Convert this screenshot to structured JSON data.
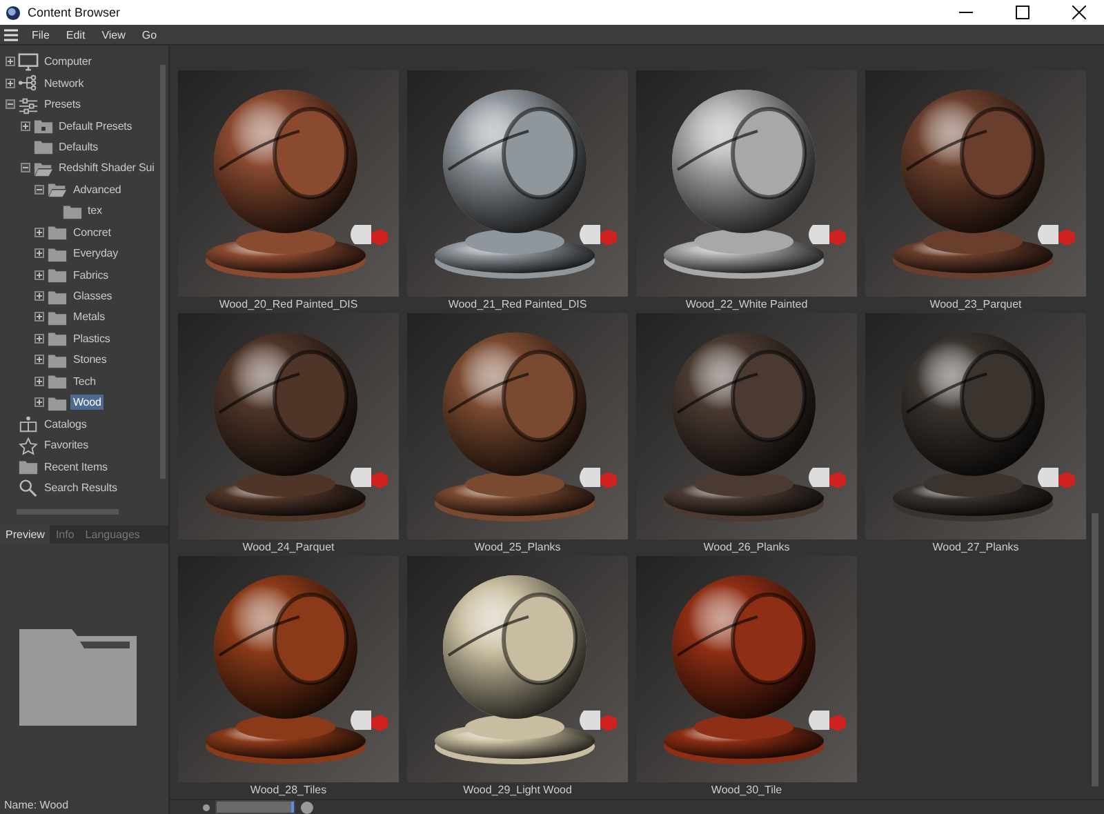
{
  "window": {
    "title": "Content Browser"
  },
  "menu": [
    "File",
    "Edit",
    "View",
    "Go"
  ],
  "tree": [
    {
      "label": "Computer",
      "kind": "monitor",
      "toggle": true,
      "expanded": false,
      "selected": false
    },
    {
      "label": "Network",
      "kind": "network",
      "toggle": true,
      "expanded": false,
      "selected": false
    },
    {
      "label": "Presets",
      "kind": "sliders",
      "toggle": true,
      "expanded": true,
      "selected": false,
      "children": [
        {
          "label": "Default Presets",
          "kind": "folder-lock",
          "toggle": true,
          "expanded": false,
          "selected": false
        },
        {
          "label": "Defaults",
          "kind": "folder",
          "toggle": false,
          "selected": false
        },
        {
          "label": "Redshift Shader Sui",
          "kind": "folder-open",
          "toggle": true,
          "expanded": true,
          "selected": false,
          "children": [
            {
              "label": "Advanced",
              "kind": "folder-open",
              "toggle": true,
              "expanded": true,
              "selected": false,
              "children": [
                {
                  "label": "tex",
                  "kind": "folder",
                  "toggle": false,
                  "selected": false
                }
              ]
            },
            {
              "label": "Concret",
              "kind": "folder",
              "toggle": true,
              "expanded": false,
              "selected": false
            },
            {
              "label": "Everyday",
              "kind": "folder",
              "toggle": true,
              "expanded": false,
              "selected": false
            },
            {
              "label": "Fabrics",
              "kind": "folder",
              "toggle": true,
              "expanded": false,
              "selected": false
            },
            {
              "label": "Glasses",
              "kind": "folder",
              "toggle": true,
              "expanded": false,
              "selected": false
            },
            {
              "label": "Metals",
              "kind": "folder",
              "toggle": true,
              "expanded": false,
              "selected": false
            },
            {
              "label": "Plastics",
              "kind": "folder",
              "toggle": true,
              "expanded": false,
              "selected": false
            },
            {
              "label": "Stones",
              "kind": "folder",
              "toggle": true,
              "expanded": false,
              "selected": false
            },
            {
              "label": "Tech",
              "kind": "folder",
              "toggle": true,
              "expanded": false,
              "selected": false
            },
            {
              "label": "Wood",
              "kind": "folder",
              "toggle": true,
              "expanded": false,
              "selected": true
            }
          ]
        }
      ]
    },
    {
      "label": "Catalogs",
      "kind": "catalog",
      "toggle": false,
      "selected": false
    },
    {
      "label": "Favorites",
      "kind": "star",
      "toggle": false,
      "selected": false
    },
    {
      "label": "Recent Items",
      "kind": "folder",
      "toggle": false,
      "selected": false
    },
    {
      "label": "Search Results",
      "kind": "search",
      "toggle": false,
      "selected": false
    }
  ],
  "tabs": [
    {
      "label": "Preview",
      "selected": true
    },
    {
      "label": "Info",
      "selected": false
    },
    {
      "label": "Languages",
      "selected": false
    }
  ],
  "preview": {
    "name": "Name: Wood"
  },
  "items": [
    {
      "label": "Wood_20_Red Painted_DIS",
      "color": "#8a4a30"
    },
    {
      "label": "Wood_21_Red Painted_DIS",
      "color": "#8f969c"
    },
    {
      "label": "Wood_22_White Painted",
      "color": "#a7a9a8"
    },
    {
      "label": "Wood_23_Parquet",
      "color": "#6a3e2c"
    },
    {
      "label": "Wood_24_Parquet",
      "color": "#4e3528"
    },
    {
      "label": "Wood_25_Planks",
      "color": "#7a4a30"
    },
    {
      "label": "Wood_26_Planks",
      "color": "#4a3a32"
    },
    {
      "label": "Wood_27_Planks",
      "color": "#3a332e"
    },
    {
      "label": "Wood_28_Tiles",
      "color": "#8a3a18"
    },
    {
      "label": "Wood_29_Light Wood",
      "color": "#c8bda0"
    },
    {
      "label": "Wood_30_Tile",
      "color": "#8e2e14"
    }
  ],
  "zoom": {
    "level": 1
  }
}
